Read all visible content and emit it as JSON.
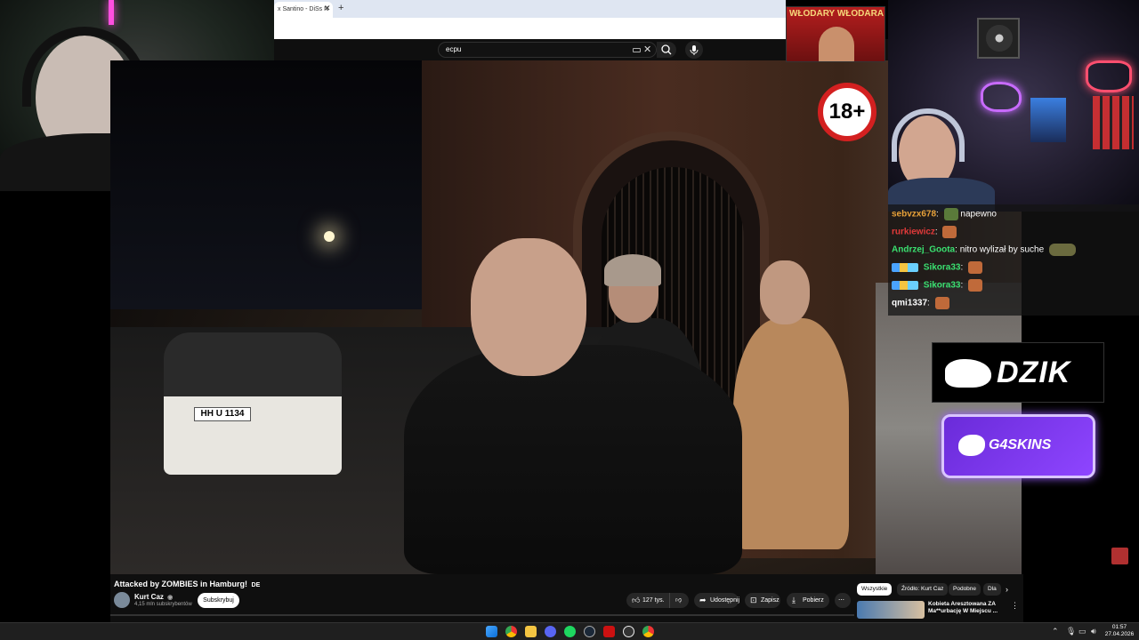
{
  "browser": {
    "tab_title": "x Santino - DiSs N",
    "new_tab": "+"
  },
  "youtube": {
    "search_value": "ecpu",
    "video": {
      "title": "Attacked by ZOMBIES in Hamburg!",
      "title_lang": "DE",
      "plate": "HH U 1134"
    },
    "channel": {
      "name": "Kurt Caz",
      "verified_mark": "◉",
      "subscribers": "4,15 mln subskrybentów",
      "subscribe_label": "Subskrybuj"
    },
    "actions": {
      "likes": "127 tys.",
      "share": "Udostępnij",
      "save": "Zapisz",
      "download": "Pobierz"
    },
    "chips": [
      "Wszystkie",
      "Źródło: Kurt Caz",
      "Podobne",
      "Dla"
    ],
    "recommendation": {
      "title": "Kobieta Aresztowana ZA Ma**urbację W Miejscu ..."
    }
  },
  "overlay": {
    "wlodary_title": "WŁODARY WŁODARA",
    "age_badge": "18+",
    "sponsor1": "DZIK",
    "sponsor2": "G4SKINS"
  },
  "chat": [
    {
      "user": "sebvzx678",
      "user_color": "#e8a23a",
      "message": "napewno"
    },
    {
      "user": "rurkiewicz",
      "user_color": "#e23a3a",
      "message": ""
    },
    {
      "user": "Andrzej_Goota",
      "user_color": "#3ae070",
      "message": "nitro wylizał by suche"
    },
    {
      "user": "Sikora33",
      "user_color": "#3ae070",
      "message": ""
    },
    {
      "user": "Sikora33",
      "user_color": "#3ae070",
      "message": ""
    },
    {
      "user": "qmi1337",
      "user_color": "#ffffff",
      "message": ""
    }
  ],
  "taskbar": {
    "time": "01:57",
    "date": "27.04.2026"
  },
  "colors": {
    "youtube_bg": "#0f0f0f",
    "g4skins_accent": "#7b3bf0",
    "age_badge_red": "#d32020"
  }
}
